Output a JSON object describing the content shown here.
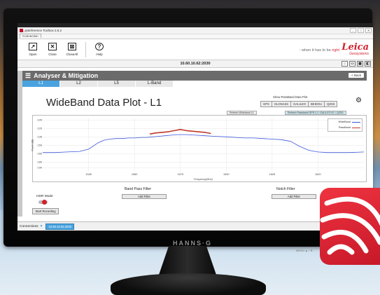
{
  "window": {
    "os_label": "HLMS",
    "title": "Interference Toolbox 2.6.2",
    "controls": [
      "–",
      "□",
      "✕"
    ],
    "tab": "Connection"
  },
  "toolbar": {
    "buttons": [
      {
        "label": "Open",
        "icon": "open-icon",
        "glyph": "↗"
      },
      {
        "label": "Close",
        "icon": "close-icon",
        "glyph": "✕"
      },
      {
        "label": "CloseAll",
        "icon": "close-all-icon",
        "glyph": "⊠"
      },
      {
        "label": "Help",
        "icon": "help-icon",
        "glyph": "?"
      }
    ],
    "tagline_pre": "- when it has to be",
    "tagline_accent": "right",
    "brand": "Leica",
    "brand_sub": "Geosystems"
  },
  "address_bar": {
    "address": "10.60.10.62:2030",
    "icons": [
      "home-icon",
      "monitor-icon",
      "grid-icon",
      "panel-icon"
    ]
  },
  "panel": {
    "title": "Analyser & Mitigation",
    "back_label": "< Back",
    "bands": [
      "L1",
      "L2",
      "L5",
      "L-Band"
    ],
    "active_band": "L1",
    "plot_title": "WideBand Data Plot - L1",
    "show_passband_label": "Show PassBand Data Plot",
    "passband_buttons": [
      "GPS",
      "GLONASS",
      "GALILEO",
      "BEIDOU",
      "QZSS"
    ],
    "refresh_wideband": "Refresh Wideband L1",
    "refresh_passband": "Refresh Passband GPS L1 / GALILEO E1 / QZSS"
  },
  "colors": {
    "accent_blue": "#4aa3df",
    "leica_red": "#d41f2d",
    "wideband_line": "#3b55d9",
    "passband_line": "#c0392b"
  },
  "chart_data": {
    "type": "line",
    "xlabel": "Frequency(MHz)",
    "ylabel": "Power(dB)",
    "xlim": [
      1530,
      1635
    ],
    "ylim": [
      -197,
      -101
    ],
    "x_ticks": [
      1545,
      1560,
      1575,
      1590,
      1605,
      1620
    ],
    "y_ticks": [
      -105,
      -120,
      -135,
      -150,
      -165,
      -180,
      -190
    ],
    "legend_placement": "top-right",
    "series": [
      {
        "name": "WideBand",
        "x": [
          1530,
          1534,
          1538,
          1542,
          1545,
          1548,
          1550,
          1552,
          1554,
          1556,
          1558,
          1560,
          1562,
          1564,
          1566,
          1568,
          1570,
          1572,
          1574,
          1575,
          1577,
          1580,
          1583,
          1586,
          1590,
          1593,
          1596,
          1599,
          1602,
          1605,
          1608,
          1611,
          1614,
          1617,
          1620,
          1623,
          1626,
          1630,
          1635
        ],
        "y": [
          -163,
          -163,
          -162,
          -161,
          -157,
          -146,
          -141,
          -139,
          -138,
          -138,
          -137,
          -137,
          -136,
          -136,
          -135,
          -134,
          -133,
          -132,
          -131,
          -131,
          -131,
          -132,
          -133,
          -134,
          -135,
          -136,
          -137,
          -137,
          -138,
          -139,
          -140,
          -143,
          -152,
          -159,
          -162,
          -163,
          -163,
          -163,
          -162
        ]
      },
      {
        "name": "PassBand",
        "x": [
          1565,
          1567,
          1569,
          1571,
          1573,
          1575,
          1577,
          1579,
          1581,
          1583,
          1585
        ],
        "y": [
          -130,
          -128,
          -127,
          -126,
          -124,
          -122,
          -124,
          -125,
          -126,
          -127,
          -129
        ]
      }
    ]
  },
  "filters": {
    "band_pass_title": "Band Pass Filter",
    "notch_title": "Notch Filter",
    "add_filter_label": "Add Filter",
    "hdr_mode_label": "HDR Mode",
    "hdr_mode_on": true,
    "start_recording_label": "Start Recording"
  },
  "status_bar": {
    "connections_label": "Connections",
    "connection_item": "10.60.10.62:2030"
  },
  "monitor": {
    "brand": "HANNS·G",
    "controls_text": "MENU   ▲ / ▼"
  }
}
